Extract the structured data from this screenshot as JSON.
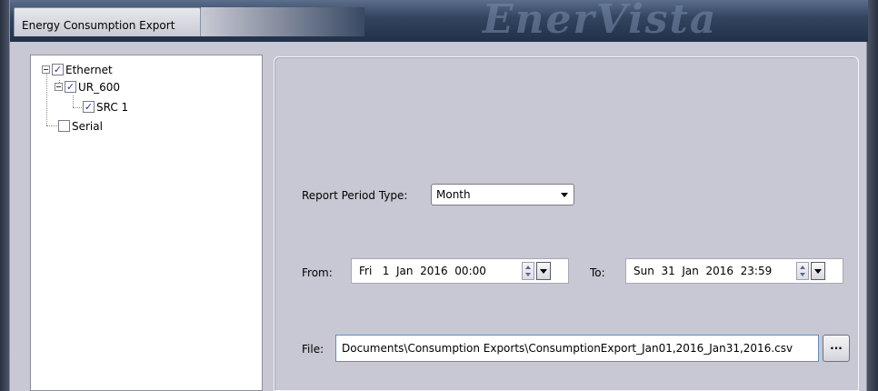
{
  "window": {
    "title": "Energy Consumption Export",
    "watermark": "EnerVista"
  },
  "tree": {
    "items": [
      {
        "label": "Ethernet",
        "checked": true,
        "check_glyph": "✓"
      },
      {
        "label": "UR_600",
        "checked": true,
        "check_glyph": "✓"
      },
      {
        "label": "SRC 1",
        "checked": true,
        "check_glyph": "✓"
      },
      {
        "label": "Serial",
        "checked": false,
        "check_glyph": ""
      }
    ]
  },
  "form": {
    "report_period_label": "Report Period Type:",
    "report_period_value": "Month",
    "from_label": "From:",
    "from_value": "Fri   1  Jan  2016  00:00",
    "to_label": "To:",
    "to_value": "Sun  31  Jan  2016  23:59",
    "file_label": "File:",
    "file_value": "Documents\\Consumption Exports\\ConsumptionExport_Jan01,2016_Jan31,2016.csv",
    "browse_label": "..."
  },
  "icons": {
    "expander": "collapse-icon",
    "checkbox": "checkbox-icon",
    "spinner": "spinner-icon",
    "dropdown": "chevron-down-icon"
  }
}
